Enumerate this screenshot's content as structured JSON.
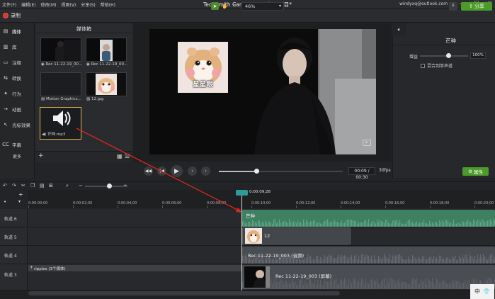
{
  "menu": [
    "文件(F)",
    "编辑(E)",
    "修改(M)",
    "视图(V)",
    "分享(S)",
    "帮助(H)"
  ],
  "app_title": "TechSmith Camtasia - 无标题项目*",
  "account": "windyxq@outlook.com",
  "window_controls": {
    "minimize": "—",
    "maximize": "☐",
    "close": "✕"
  },
  "toolbar": {
    "record": "录制",
    "zoom": "46%",
    "share": "分享"
  },
  "nav": [
    {
      "icon": "media-icon",
      "glyph": "▤",
      "label": "媒体"
    },
    {
      "icon": "library-icon",
      "glyph": "▥",
      "label": "库"
    },
    {
      "icon": "annotations-icon",
      "glyph": "▭",
      "label": "注释"
    },
    {
      "icon": "transitions-icon",
      "glyph": "⇆",
      "label": "转换"
    },
    {
      "icon": "behaviors-icon",
      "glyph": "✦",
      "label": "行为"
    },
    {
      "icon": "animations-icon",
      "glyph": "→",
      "label": "动画"
    },
    {
      "icon": "cursor-effects-icon",
      "glyph": "↖",
      "label": "光标效果"
    },
    {
      "icon": "captions-icon",
      "glyph": "CC",
      "label": "字幕"
    }
  ],
  "nav_more": "更多",
  "bin": {
    "title": "媒体箱",
    "items": [
      {
        "label": "Rec 11-22-19_00...",
        "type": "video"
      },
      {
        "label": "Rec 11-22-19_00...",
        "type": "video"
      },
      {
        "label": "Motion Graphics...",
        "type": "motion"
      },
      {
        "label": "12.jpg",
        "type": "image"
      },
      {
        "label": "芒种.mp3",
        "type": "audio"
      }
    ]
  },
  "canvas": {
    "overlay_text": "星星眼"
  },
  "transport": {
    "time": "00:09 / 00:30",
    "fps": "30fps",
    "progress": 0.3
  },
  "properties": {
    "title": "芒种",
    "gain_label": "增益",
    "gain_value": "100%",
    "mix_label": "混合到单声道",
    "button": "属性"
  },
  "timeline": {
    "playhead_time": "0:00:09;28",
    "ticks": [
      "0:00:00;00",
      "0:00:02;00",
      "0:00:04;00",
      "0:00:06;00",
      "0:00:08;00",
      "0:00:10;00",
      "0:00:12;00",
      "0:00:14;00",
      "0:00:16;00",
      "0:00:18;00",
      "0:00:20;00"
    ],
    "tracks": [
      {
        "name": "轨道 6",
        "clip": "芒种"
      },
      {
        "name": "轨道 5",
        "clip": "12"
      },
      {
        "name": "轨道 4",
        "clip": "Rec 11-22-19_003 (音频)"
      },
      {
        "name": "轨道 3",
        "clip": "Rec 11-22-19_003 (屏幕)"
      }
    ],
    "ripple": "ripples",
    "ripple_count": "(3个媒体)"
  },
  "ime": {
    "lang": "中",
    "shirt": "👕"
  },
  "colors": {
    "accent_green": "#4b9a2a",
    "playhead": "#2e9a9a",
    "audio_clip": "#3f7f62",
    "arrow": "#d9271e"
  }
}
